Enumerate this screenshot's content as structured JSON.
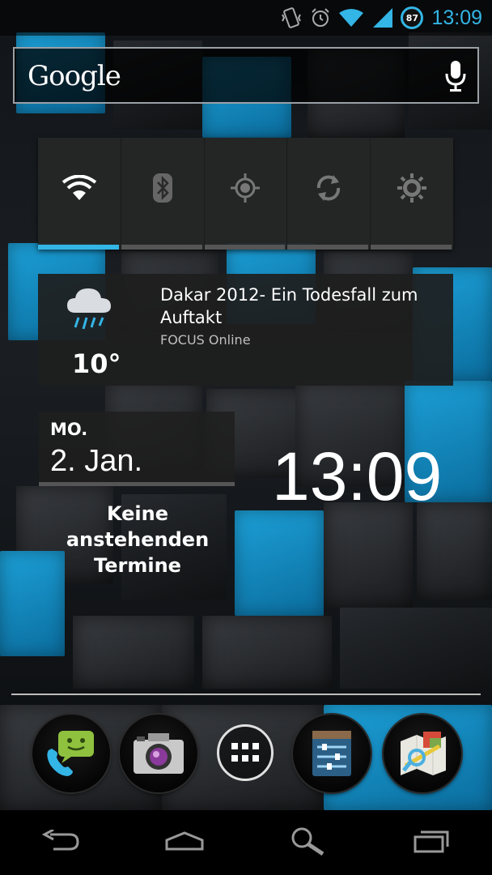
{
  "status_bar": {
    "time": "13:09",
    "battery_level": "87",
    "icons": [
      "vibrate-icon",
      "alarm-icon",
      "wifi-icon",
      "signal-icon",
      "battery-icon"
    ],
    "accent_color": "#33b5e5"
  },
  "search": {
    "logo_text": "Google",
    "icon": "mic-icon"
  },
  "power_control": {
    "toggles": [
      {
        "name": "wifi",
        "icon": "wifi-icon",
        "on": true
      },
      {
        "name": "bluetooth",
        "icon": "bluetooth-icon",
        "on": false
      },
      {
        "name": "gps",
        "icon": "gps-icon",
        "on": false
      },
      {
        "name": "sync",
        "icon": "sync-icon",
        "on": false
      },
      {
        "name": "brightness",
        "icon": "brightness-icon",
        "on": false
      }
    ]
  },
  "news_widget": {
    "temperature": "10°",
    "weather_icon": "rain-cloud-icon",
    "headline": "Dakar 2012- Ein Todesfall zum Auftakt",
    "source": "FOCUS Online"
  },
  "calendar": {
    "day_of_week": "MO.",
    "date": "2. Jan.",
    "no_events": "Keine anstehenden Termine"
  },
  "clock": {
    "time": "13:09"
  },
  "dock": {
    "apps": [
      "messaging-phone-icon",
      "camera-icon",
      "all-apps-icon",
      "settings-icon",
      "maps-icon"
    ]
  },
  "nav_bar": {
    "buttons": [
      "back-icon",
      "home-icon",
      "search-icon",
      "recents-icon"
    ]
  }
}
